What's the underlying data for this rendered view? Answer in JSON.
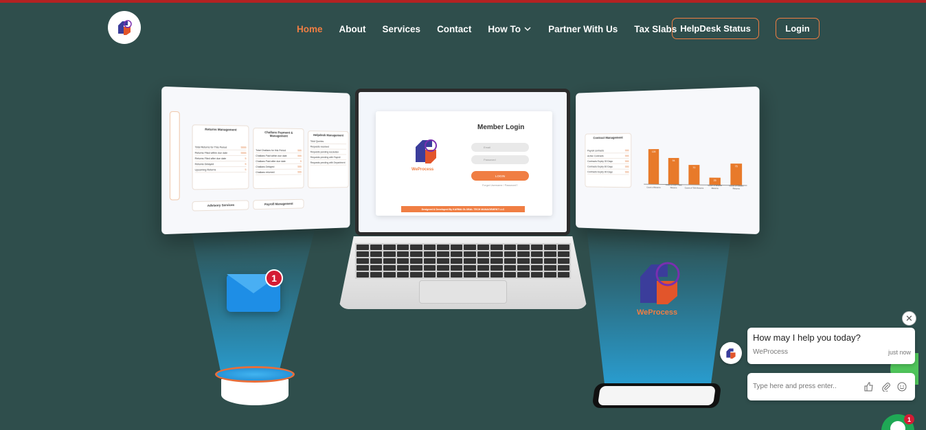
{
  "brand": {
    "logo_text": "WeProcess",
    "colors": {
      "accent": "#f07e43",
      "background": "#2f4e4c",
      "topbar": "#b32222"
    }
  },
  "nav": {
    "items": [
      {
        "label": "Home",
        "active": true
      },
      {
        "label": "About"
      },
      {
        "label": "Services"
      },
      {
        "label": "Contact"
      },
      {
        "label": "How To",
        "has_dropdown": true
      },
      {
        "label": "Partner With Us"
      },
      {
        "label": "Tax Slabs"
      }
    ],
    "helpdesk_label": "HelpDesk Status",
    "login_label": "Login"
  },
  "hero": {
    "laptop": {
      "title": "Member Login",
      "email_placeholder": "Email",
      "password_placeholder": "Password",
      "login_button": "LOGIN",
      "forgot": "Forgot Username / Password?",
      "footer": "Designed & Developed By KARMA GLOBAL TECH MANAGEMENT LLC",
      "logo_text": "WeProcess"
    },
    "left_panel": {
      "cards": [
        {
          "title": "Returns Management",
          "rows": [
            [
              "Total Returns for This Period",
              "5555"
            ],
            [
              "Returns Filed within due date",
              "5555"
            ],
            [
              "Returns Filed after due date",
              "5"
            ],
            [
              "Returns Delayed",
              "5"
            ],
            [
              "Upcoming Returns",
              "5"
            ]
          ]
        },
        {
          "title": "Challans Payment & Management",
          "rows": [
            [
              "Total Challans for this Period",
              "555"
            ],
            [
              "Challans Paid within due date",
              "555"
            ],
            [
              "Challans Paid after due date",
              "5"
            ],
            [
              "Challans Delayed",
              "555"
            ],
            [
              "Challans returned",
              "555"
            ]
          ]
        },
        {
          "title": "Helpdesk Management",
          "rows": [
            [
              "Total Queries",
              ""
            ],
            [
              "Requests resolved",
              ""
            ],
            [
              "Requests pending resolution",
              ""
            ],
            [
              "Requests pending with Payroll",
              ""
            ],
            [
              "Requests pending with Department",
              ""
            ]
          ]
        }
      ],
      "bottom_tabs": [
        "Advisory Services",
        "Payroll Management"
      ]
    },
    "right_panel": {
      "card": {
        "title": "Contract Management",
        "rows": [
          [
            "Payroll contracts",
            "555"
          ],
          [
            "Active Contracts",
            "555"
          ],
          [
            "Contracts Expiry 30 Days",
            "555"
          ],
          [
            "Contracts Expiry 60 Days",
            "555"
          ],
          [
            "Contracts Expiry 90 Days",
            "555"
          ]
        ]
      }
    },
    "envelope_badge": "1",
    "big_logo_text": "WeProcess"
  },
  "chart_data": {
    "type": "bar",
    "categories": [
      "Count of Returns",
      "Count of GST Filed Returns",
      "Count of TDS Returns",
      "Count of ESI/PF Returns",
      "Count of Others Returns"
    ],
    "values": [
      128,
      94,
      70,
      26,
      75
    ],
    "ylim": [
      0,
      140
    ],
    "color": "#e87a2a"
  },
  "chat": {
    "message": "How may I help you today?",
    "sender": "WeProcess",
    "time": "just now",
    "input_placeholder": "Type here and press enter..",
    "close_glyph": "✕",
    "fab_badge": "1"
  }
}
